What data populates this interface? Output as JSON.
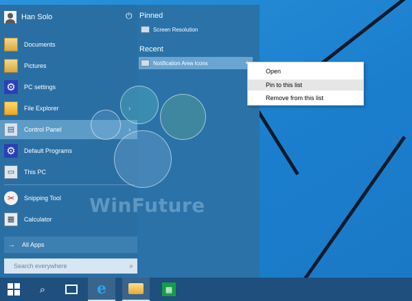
{
  "user": {
    "name": "Han Solo"
  },
  "left_menu": [
    {
      "label": "Documents",
      "icon": "documents-icon",
      "glyph": ""
    },
    {
      "label": "Pictures",
      "icon": "pictures-icon",
      "glyph": ""
    },
    {
      "label": "PC settings",
      "icon": "gear-icon",
      "glyph": "⚙"
    },
    {
      "label": "File Explorer",
      "icon": "file-explorer-icon",
      "glyph": ""
    },
    {
      "label": "Control Panel",
      "icon": "control-panel-icon",
      "glyph": "▤"
    },
    {
      "label": "Default Programs",
      "icon": "default-programs-icon",
      "glyph": "⚙"
    },
    {
      "label": "This PC",
      "icon": "this-pc-icon",
      "glyph": "▭"
    },
    {
      "label": "Snipping Tool",
      "icon": "scissors-icon",
      "glyph": "✂"
    },
    {
      "label": "Calculator",
      "icon": "calculator-icon",
      "glyph": "▦"
    }
  ],
  "all_apps": {
    "label": "All Apps",
    "arrow": "→"
  },
  "search": {
    "placeholder": "Search everywhere",
    "icon_glyph": "⌕"
  },
  "right_panel": {
    "power_glyph": "⏻",
    "pinned_title": "Pinned",
    "pinned_items": [
      {
        "label": "Screen Resolution"
      }
    ],
    "recent_title": "Recent",
    "recent_items": [
      {
        "label": "Notification Area Icons",
        "pin_glyph": "✦"
      }
    ]
  },
  "context_menu": {
    "items": [
      {
        "label": "Open"
      },
      {
        "label": "Pin to this list"
      },
      {
        "label": "Remove from this list"
      }
    ]
  },
  "watermark": "WinFuture",
  "taskbar": {
    "search_glyph": "⌕",
    "ie_glyph": "e",
    "store_glyph": "▦"
  },
  "colors": {
    "start_menu": "#2a72a8",
    "taskbar": "#1e4f7d",
    "desktop": "#1e85d2",
    "selection": "#5e9cc8"
  }
}
